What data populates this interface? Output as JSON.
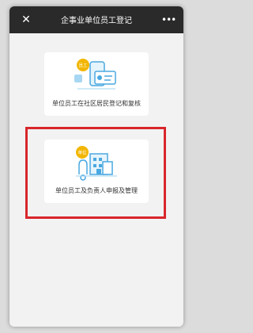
{
  "header": {
    "title": "企事业单位员工登记",
    "close_icon": "close-icon",
    "more_icon": "more-icon"
  },
  "cards": [
    {
      "label": "单位员工在社区居民登记和复核",
      "badge": "员工",
      "icon": "phone-id-card-icon"
    },
    {
      "label": "单位员工及负责人申报及管理",
      "badge": "单位",
      "icon": "building-icon"
    }
  ],
  "colors": {
    "titlebar": "#2a2a2a",
    "accent_blue": "#4aa8e0",
    "badge_yellow": "#f2b600",
    "highlight_red": "#d8262b"
  }
}
